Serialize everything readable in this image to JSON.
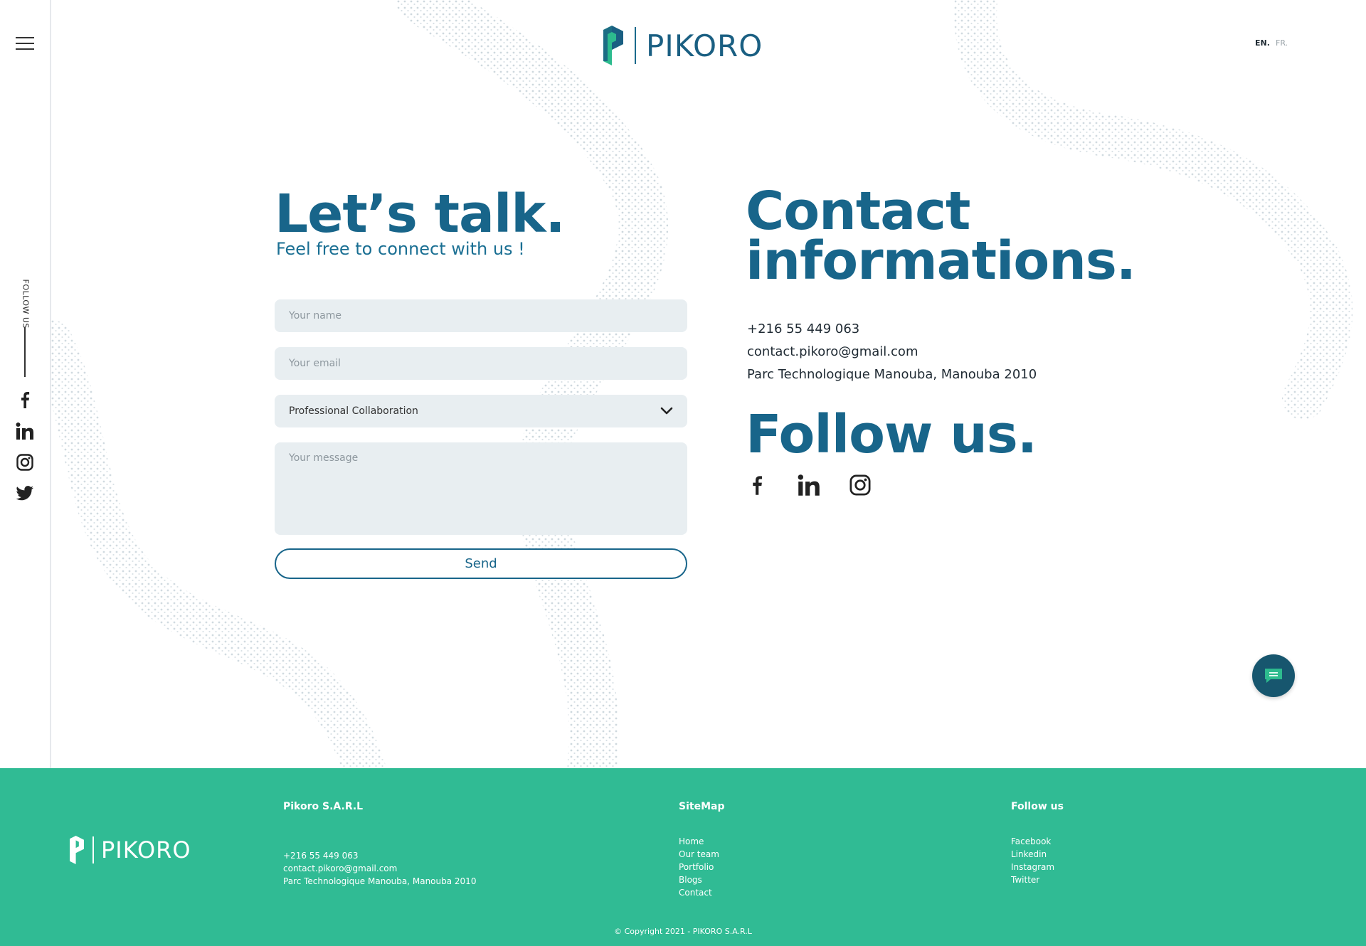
{
  "brand": {
    "name": "PIKORO",
    "color_primary": "#18658a",
    "color_accent": "#30bb94",
    "color_logo_teal": "#2dbb8e"
  },
  "rail": {
    "follow_label": "FOLLOW US",
    "menu_icon": "hamburger-menu-icon",
    "social_icons": [
      "facebook-icon",
      "linkedin-icon",
      "instagram-icon",
      "twitter-icon"
    ]
  },
  "header": {
    "lang_en": "EN.",
    "lang_fr": "FR."
  },
  "form": {
    "title": "Let’s talk.",
    "subtitle": "Feel free to connect with us !",
    "name_placeholder": "Your name",
    "email_placeholder": "Your email",
    "subject_value": "Professional  Collaboration",
    "message_placeholder": "Your message",
    "send_label": "Send"
  },
  "contact": {
    "title": "Contact informations.",
    "phone": "+216 55 449 063",
    "email": "contact.pikoro@gmail.com",
    "address": "Parc Technologique Manouba, Manouba 2010",
    "follow_title": "Follow us.",
    "social_icons": [
      "facebook-icon",
      "linkedin-icon",
      "instagram-icon"
    ]
  },
  "chat": {
    "icon": "chat-icon"
  },
  "footer": {
    "company_heading": "Pikoro S.A.R.L",
    "phone": "+216 55 449 063",
    "email": "contact.pikoro@gmail.com",
    "address": " Parc Technologique Manouba, Manouba 2010",
    "sitemap_heading": "SiteMap",
    "sitemap": [
      "Home",
      "Our team",
      "Portfolio",
      "Blogs",
      "Contact"
    ],
    "follow_heading": "Follow us",
    "follow_links": [
      "Facebook",
      "Linkedin",
      "Instagram",
      "Twitter"
    ],
    "copyright": "© Copyright 2021 - PIKORO S.A.R.L"
  }
}
